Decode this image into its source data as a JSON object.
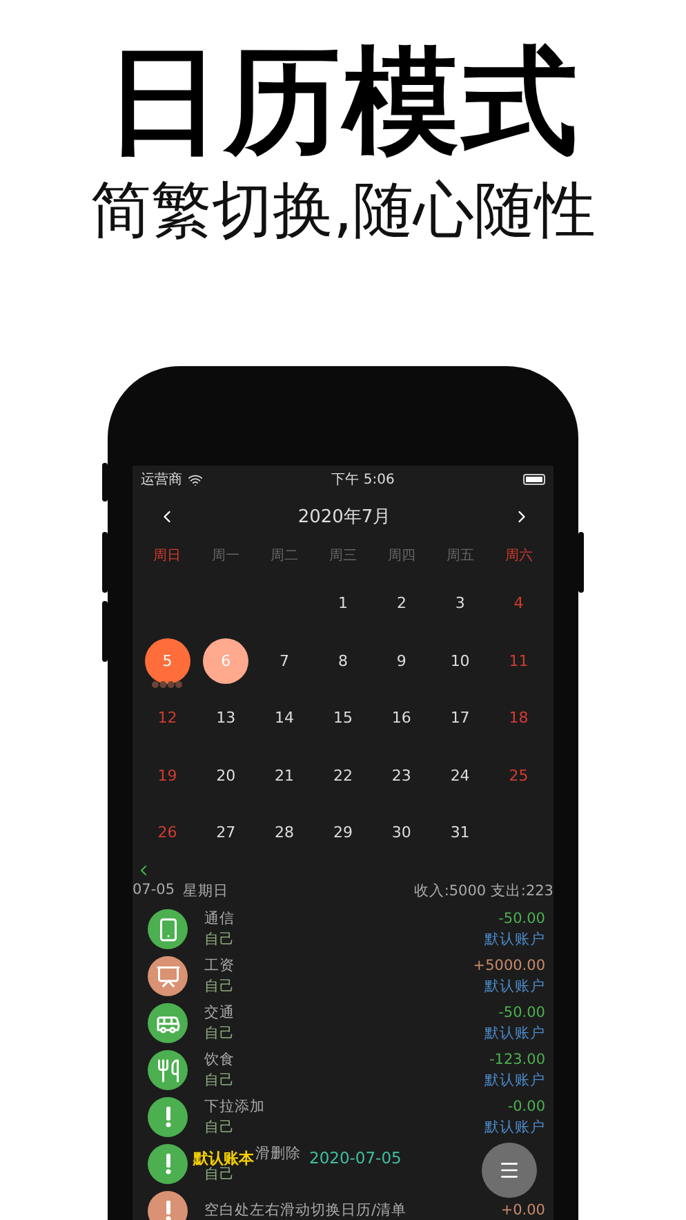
{
  "headline": "日历模式",
  "subtitle": "简繁切换,随心随性",
  "status_bar": {
    "carrier": "运营商",
    "time": "下午 5:06"
  },
  "calendar": {
    "title": "2020年7月",
    "weekdays": [
      {
        "label": "周日",
        "weekend": true
      },
      {
        "label": "周一",
        "weekend": false
      },
      {
        "label": "周二",
        "weekend": false
      },
      {
        "label": "周三",
        "weekend": false
      },
      {
        "label": "周四",
        "weekend": false
      },
      {
        "label": "周五",
        "weekend": false
      },
      {
        "label": "周六",
        "weekend": true
      }
    ],
    "weeks": [
      [
        {
          "day": "1",
          "weekend": false,
          "selected": false,
          "today": false
        },
        {
          "day": "2",
          "weekend": false,
          "selected": false,
          "today": false
        },
        {
          "day": "3",
          "weekend": false,
          "selected": false,
          "today": false
        },
        {
          "day": "4",
          "weekend": true,
          "selected": false,
          "today": false
        }
      ],
      [
        {
          "day": "5",
          "weekend": true,
          "selected": true,
          "today": false,
          "has_records": true
        },
        {
          "day": "6",
          "weekend": false,
          "selected": false,
          "today": true
        },
        {
          "day": "7",
          "weekend": false,
          "selected": false,
          "today": false
        },
        {
          "day": "8",
          "weekend": false,
          "selected": false,
          "today": false
        },
        {
          "day": "9",
          "weekend": false,
          "selected": false,
          "today": false
        },
        {
          "day": "10",
          "weekend": false,
          "selected": false,
          "today": false
        },
        {
          "day": "11",
          "weekend": true,
          "selected": false,
          "today": false
        }
      ],
      [
        {
          "day": "12",
          "weekend": true,
          "selected": false,
          "today": false
        },
        {
          "day": "13",
          "weekend": false,
          "selected": false,
          "today": false
        },
        {
          "day": "14",
          "weekend": false,
          "selected": false,
          "today": false
        },
        {
          "day": "15",
          "weekend": false,
          "selected": false,
          "today": false
        },
        {
          "day": "16",
          "weekend": false,
          "selected": false,
          "today": false
        },
        {
          "day": "17",
          "weekend": false,
          "selected": false,
          "today": false
        },
        {
          "day": "18",
          "weekend": true,
          "selected": false,
          "today": false
        }
      ],
      [
        {
          "day": "19",
          "weekend": true,
          "selected": false,
          "today": false
        },
        {
          "day": "20",
          "weekend": false,
          "selected": false,
          "today": false
        },
        {
          "day": "21",
          "weekend": false,
          "selected": false,
          "today": false
        },
        {
          "day": "22",
          "weekend": false,
          "selected": false,
          "today": false
        },
        {
          "day": "23",
          "weekend": false,
          "selected": false,
          "today": false
        },
        {
          "day": "24",
          "weekend": false,
          "selected": false,
          "today": false
        },
        {
          "day": "25",
          "weekend": true,
          "selected": false,
          "today": false
        }
      ],
      [
        {
          "day": "26",
          "weekend": true,
          "selected": false,
          "today": false
        },
        {
          "day": "27",
          "weekend": false,
          "selected": false,
          "today": false
        },
        {
          "day": "28",
          "weekend": false,
          "selected": false,
          "today": false
        },
        {
          "day": "29",
          "weekend": false,
          "selected": false,
          "today": false
        },
        {
          "day": "30",
          "weekend": false,
          "selected": false,
          "today": false
        },
        {
          "day": "31",
          "weekend": false,
          "selected": false,
          "today": false
        }
      ]
    ]
  },
  "summary": {
    "date": "07-05",
    "weekday": "星期日",
    "totals": "收入:5000 支出:223"
  },
  "records": [
    {
      "kind": "phone",
      "color": "#4caf50",
      "title": "通信",
      "member": "自己",
      "amount": "-50.00",
      "income": false,
      "account": "默认账户"
    },
    {
      "kind": "presentation",
      "color": "#d99273",
      "title": "工资",
      "member": "自己",
      "amount": "+5000.00",
      "income": true,
      "account": "默认账户"
    },
    {
      "kind": "bus",
      "color": "#4caf50",
      "title": "交通",
      "member": "自己",
      "amount": "-50.00",
      "income": false,
      "account": "默认账户"
    },
    {
      "kind": "food",
      "color": "#4caf50",
      "title": "饮食",
      "member": "自己",
      "amount": "-123.00",
      "income": false,
      "account": "默认账户"
    },
    {
      "kind": "alert",
      "color": "#4caf50",
      "title": "下拉添加",
      "member": "自己",
      "amount": "-0.00",
      "income": false,
      "account": "默认账户"
    },
    {
      "kind": "alert",
      "color": "#4caf50",
      "title": "滑删除",
      "member": "自己"
    },
    {
      "kind": "alert",
      "color": "#d99273",
      "title": "空白处左右滑动切换日历/清单",
      "amount": "+0.00",
      "income": true
    }
  ],
  "overlay": {
    "book": "默认账本",
    "date": "2020-07-05"
  }
}
